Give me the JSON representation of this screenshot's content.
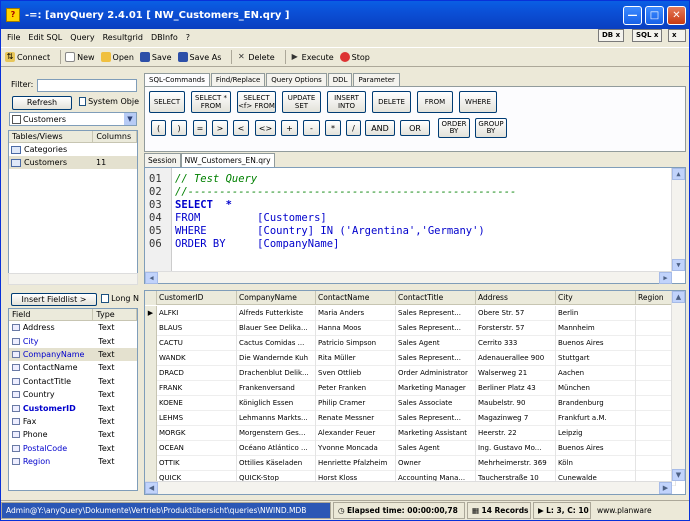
{
  "window": {
    "title": "-=: [anyQuery 2.4.01 [ NW_Customers_EN.qry ]",
    "controls": [
      "minimize",
      "maximize",
      "close"
    ]
  },
  "menu": [
    "File",
    "Edit SQL",
    "Query",
    "Resultgrid",
    "DBInfo",
    "?"
  ],
  "tag_buttons": {
    "db": "DB x",
    "sql": "SQL x"
  },
  "toolbar": [
    {
      "label": "Connect",
      "icon": "connect-icon"
    },
    {
      "label": "New",
      "icon": "new-icon"
    },
    {
      "label": "Open",
      "icon": "open-icon"
    },
    {
      "label": "Save",
      "icon": "save-icon"
    },
    {
      "label": "Save As",
      "icon": "save-as-icon"
    },
    {
      "label": "Delete",
      "icon": "delete-icon"
    },
    {
      "label": "Execute",
      "icon": "execute-icon"
    },
    {
      "label": "Stop",
      "icon": "stop-icon"
    }
  ],
  "left": {
    "filter_label": "Filter:",
    "filter_value": "",
    "refresh_label": "Refresh",
    "system_objects_label": "System Obje",
    "database": "Customers",
    "list_headers": [
      "Tables/Views",
      "Columns"
    ],
    "tables": [
      {
        "name": "Categories",
        "columns": ""
      },
      {
        "name": "Customers",
        "columns": "11"
      }
    ],
    "insert_fieldlist_label": "Insert Fieldlist >",
    "long_names_label": "Long N",
    "field_headers": [
      "Field",
      "Type"
    ],
    "fields": [
      {
        "name": "Address",
        "type": "Text",
        "style": ""
      },
      {
        "name": "City",
        "type": "Text",
        "style": "key"
      },
      {
        "name": "CompanyName",
        "type": "Text",
        "style": "key"
      },
      {
        "name": "ContactName",
        "type": "Text",
        "style": ""
      },
      {
        "name": "ContactTitle",
        "type": "Text",
        "style": ""
      },
      {
        "name": "Country",
        "type": "Text",
        "style": ""
      },
      {
        "name": "CustomerID",
        "type": "Text",
        "style": "pk"
      },
      {
        "name": "Fax",
        "type": "Text",
        "style": ""
      },
      {
        "name": "Phone",
        "type": "Text",
        "style": ""
      },
      {
        "name": "PostalCode",
        "type": "Text",
        "style": "key"
      },
      {
        "name": "Region",
        "type": "Text",
        "style": "key"
      }
    ]
  },
  "sql_tabs": [
    "SQL-Commands",
    "Find/Replace",
    "Query Options",
    "DDL",
    "Parameter"
  ],
  "sql_buttons_row1": [
    "SELECT",
    "SELECT *\nFROM",
    "SELECT\n<f> FROM",
    "UPDATE\nSET",
    "INSERT\nINTO",
    "DELETE",
    "FROM",
    "WHERE"
  ],
  "sql_buttons_row2": [
    "(",
    ")",
    "=",
    ">",
    "<",
    "<>",
    "+",
    "-",
    "*",
    "/",
    "AND",
    "OR",
    "ORDER\nBY",
    "GROUP\nBY"
  ],
  "editor_tabs": [
    "Session",
    "NW_Customers_EN.qry"
  ],
  "editor": {
    "lines": [
      {
        "no": "01",
        "text": "// Test Query"
      },
      {
        "no": "02",
        "text": "//----------------------------------------------------"
      },
      {
        "no": "03",
        "text": "SELECT  *"
      },
      {
        "no": "04",
        "text": "FROM         [Customers]"
      },
      {
        "no": "05",
        "text": "WHERE        [Country] IN ('Argentina','Germany')"
      },
      {
        "no": "06",
        "text": "ORDER BY     [CompanyName]"
      }
    ]
  },
  "grid": {
    "headers": [
      "CustomerID",
      "CompanyName",
      "ContactName",
      "ContactTitle",
      "Address",
      "City",
      "Region"
    ],
    "rows": [
      [
        "ALFKI",
        "Alfreds Futterkiste",
        "Maria Anders",
        "Sales Represent...",
        "Obere Str. 57",
        "Berlin",
        ""
      ],
      [
        "BLAUS",
        "Blauer See Delika...",
        "Hanna Moos",
        "Sales Represent...",
        "Forsterstr. 57",
        "Mannheim",
        ""
      ],
      [
        "CACTU",
        "Cactus Comidas ...",
        "Patricio Simpson",
        "Sales Agent",
        "Cerrito 333",
        "Buenos Aires",
        ""
      ],
      [
        "WANDK",
        "Die Wandernde Kuh",
        "Rita Müller",
        "Sales Represent...",
        "Adenauerallee 900",
        "Stuttgart",
        ""
      ],
      [
        "DRACD",
        "Drachenblut Delik...",
        "Sven Ottlieb",
        "Order Administrator",
        "Walserweg 21",
        "Aachen",
        ""
      ],
      [
        "FRANK",
        "Frankenversand",
        "Peter Franken",
        "Marketing Manager",
        "Berliner Platz 43",
        "München",
        ""
      ],
      [
        "KOENE",
        "Königlich Essen",
        "Philip Cramer",
        "Sales Associate",
        "Maubelstr. 90",
        "Brandenburg",
        ""
      ],
      [
        "LEHMS",
        "Lehmanns Markts...",
        "Renate Messner",
        "Sales Represent...",
        "Magazinweg 7",
        "Frankfurt a.M.",
        ""
      ],
      [
        "MORGK",
        "Morgenstern Ges...",
        "Alexander Feuer",
        "Marketing Assistant",
        "Heerstr. 22",
        "Leipzig",
        ""
      ],
      [
        "OCEAN",
        "Océano Atlántico ...",
        "Yvonne Moncada",
        "Sales Agent",
        "Ing. Gustavo Mo...",
        "Buenos Aires",
        ""
      ],
      [
        "OTTIK",
        "Ottilies Käseladen",
        "Henriette Pfalzheim",
        "Owner",
        "Mehrheimerstr. 369",
        "Köln",
        ""
      ],
      [
        "QUICK",
        "QUICK-Stop",
        "Horst Kloss",
        "Accounting Mana...",
        "Taucherstraße 10",
        "Cunewalde",
        ""
      ]
    ]
  },
  "status": {
    "path": "Admin@Y:\\anyQuery\\Dokumente\\Vertrieb\\Produktübersicht\\queries\\NWIND.MDB",
    "elapsed": "Elapsed time: 00:00:00,78",
    "records": "14 Records",
    "cursor": "L: 3, C: 10",
    "brand": "www.planware"
  }
}
